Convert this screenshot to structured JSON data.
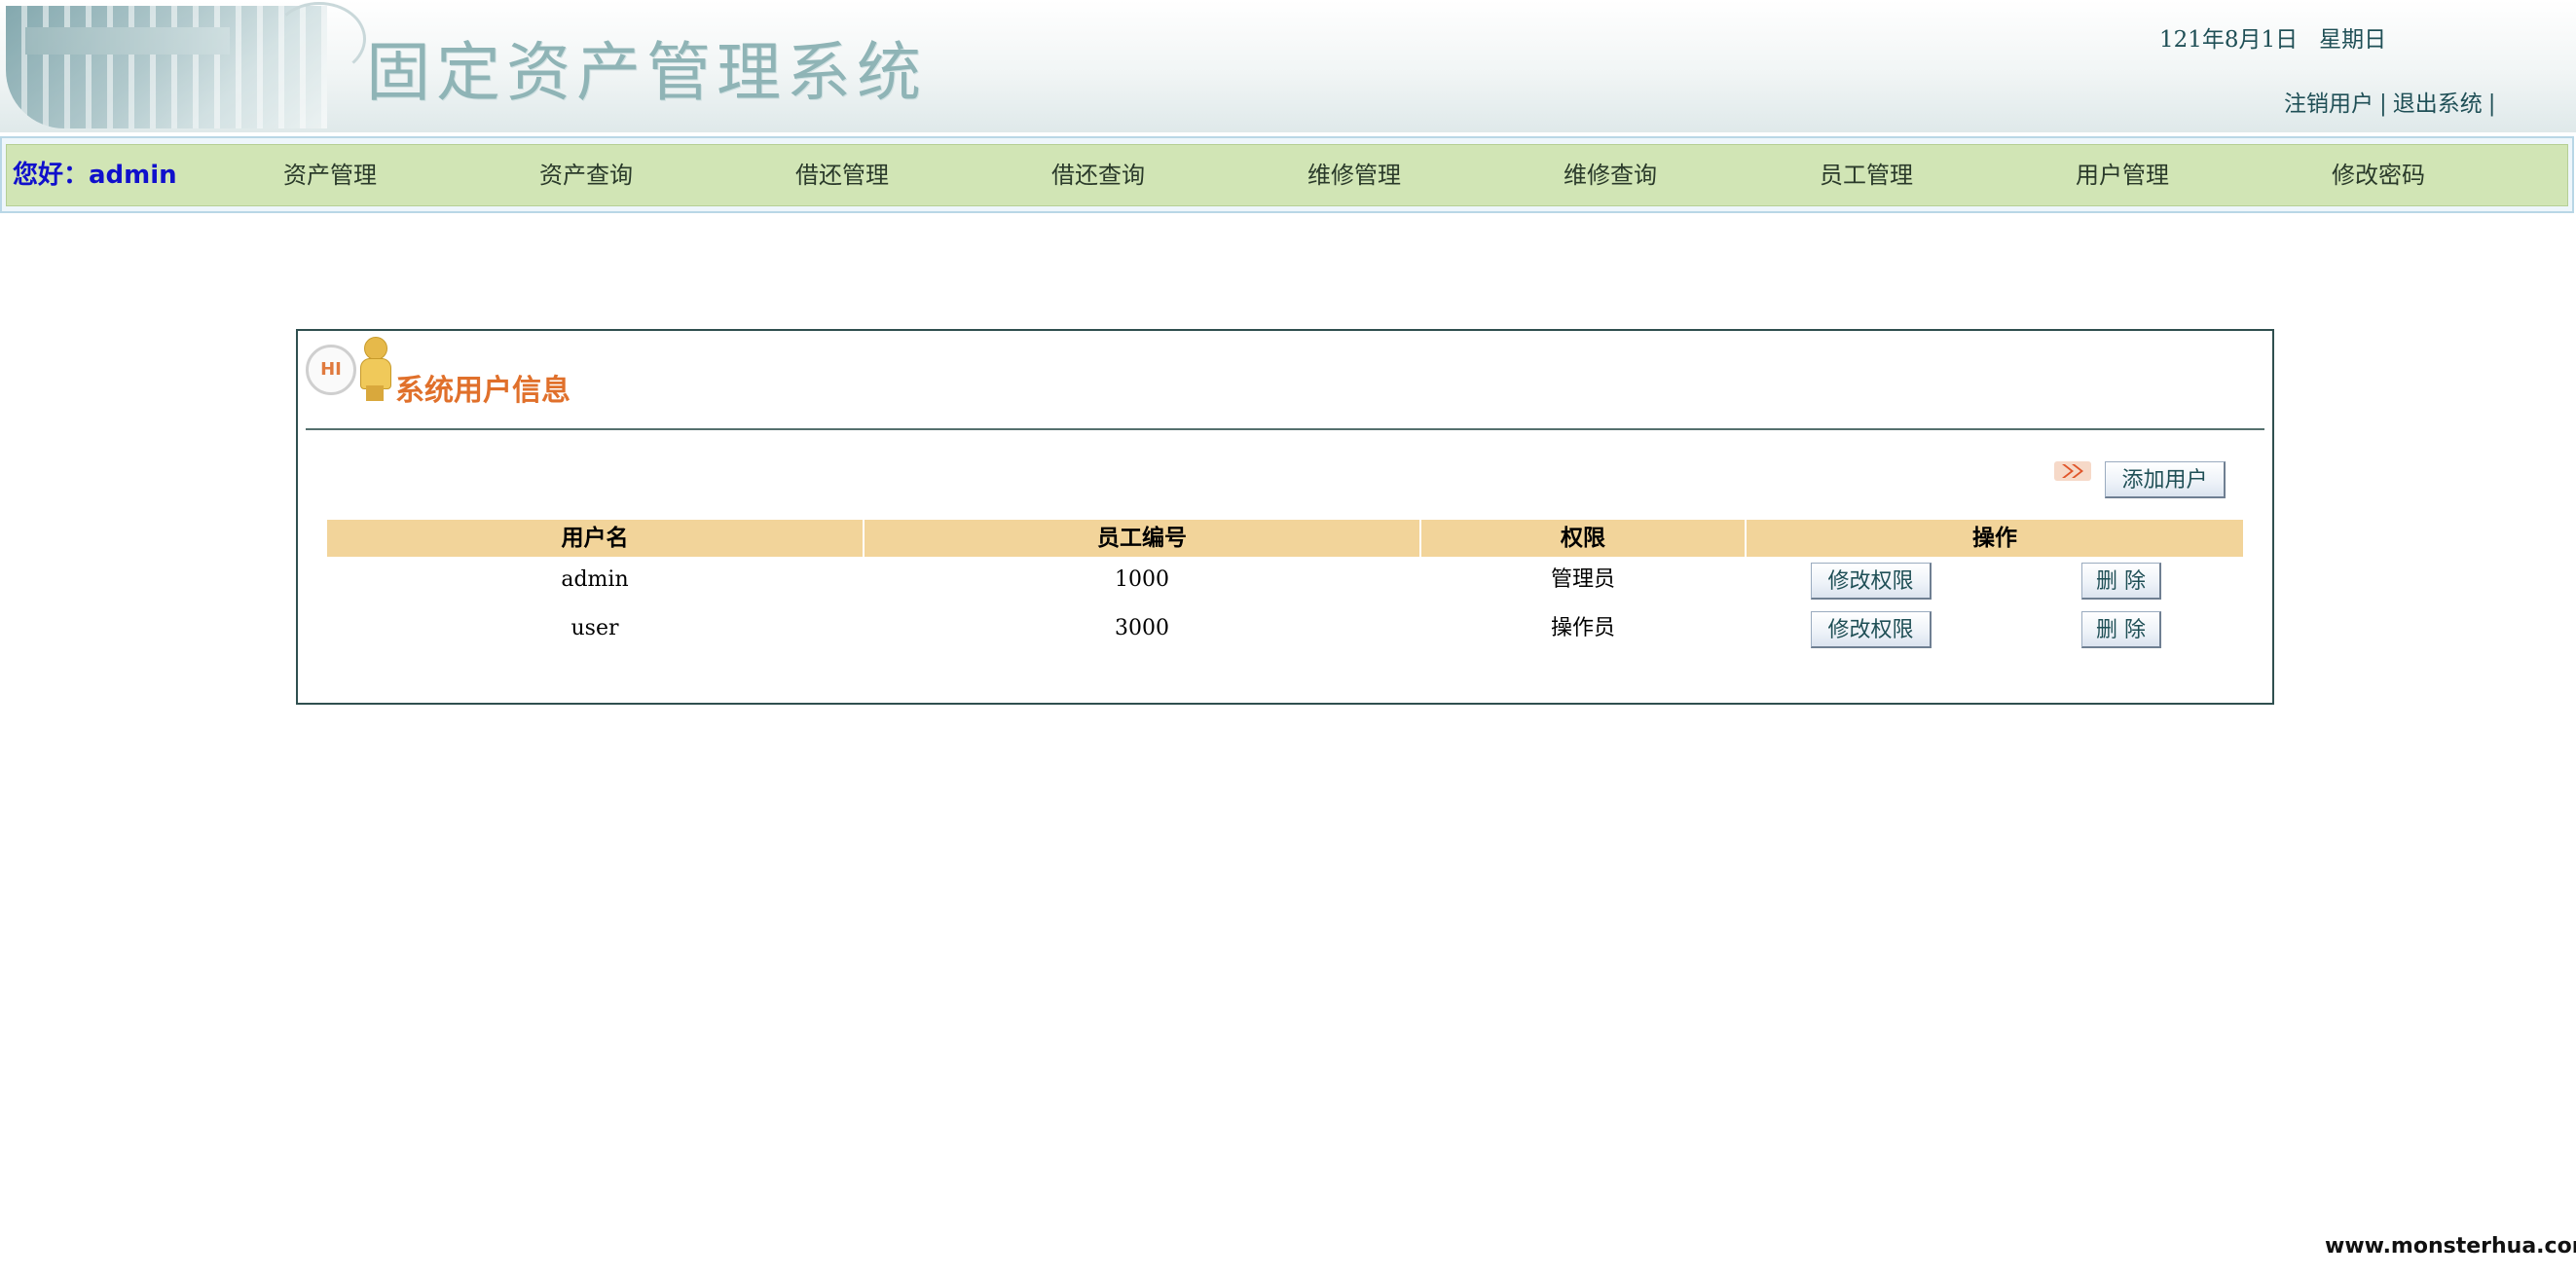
{
  "header": {
    "title": "固定资产管理系统",
    "date": "121年8月1日",
    "weekday": "星期日",
    "links": {
      "logout": "注销用户",
      "separator": "|",
      "exit": "退出系统",
      "trailing_separator": "|"
    }
  },
  "nav": {
    "greeting": "您好：admin",
    "items": [
      "资产管理",
      "资产查询",
      "借还管理",
      "借还查询",
      "维修管理",
      "维修查询",
      "员工管理",
      "用户管理",
      "修改密码"
    ]
  },
  "panel": {
    "hi_badge": "HI",
    "title": "系统用户信息",
    "add_button": "添加用户",
    "table": {
      "headers": [
        "用户名",
        "员工编号",
        "权限",
        "操作"
      ],
      "rows": [
        {
          "username": "admin",
          "employee_id": "1000",
          "role": "管理员",
          "edit": "修改权限",
          "delete": "删 除"
        },
        {
          "username": "user",
          "employee_id": "3000",
          "role": "操作员",
          "edit": "修改权限",
          "delete": "删 除"
        }
      ]
    }
  },
  "watermark": "www.monsterhua.com",
  "colors": {
    "nav_bg": "#d1e5b5",
    "greeting": "#1010cc",
    "panel_title": "#e0702b",
    "table_header_bg": "#f2d49a",
    "header_text": "#1f4f56"
  },
  "icons": [
    "building-photo-icon",
    "hi-person-icon",
    "double-arrow-icon"
  ]
}
